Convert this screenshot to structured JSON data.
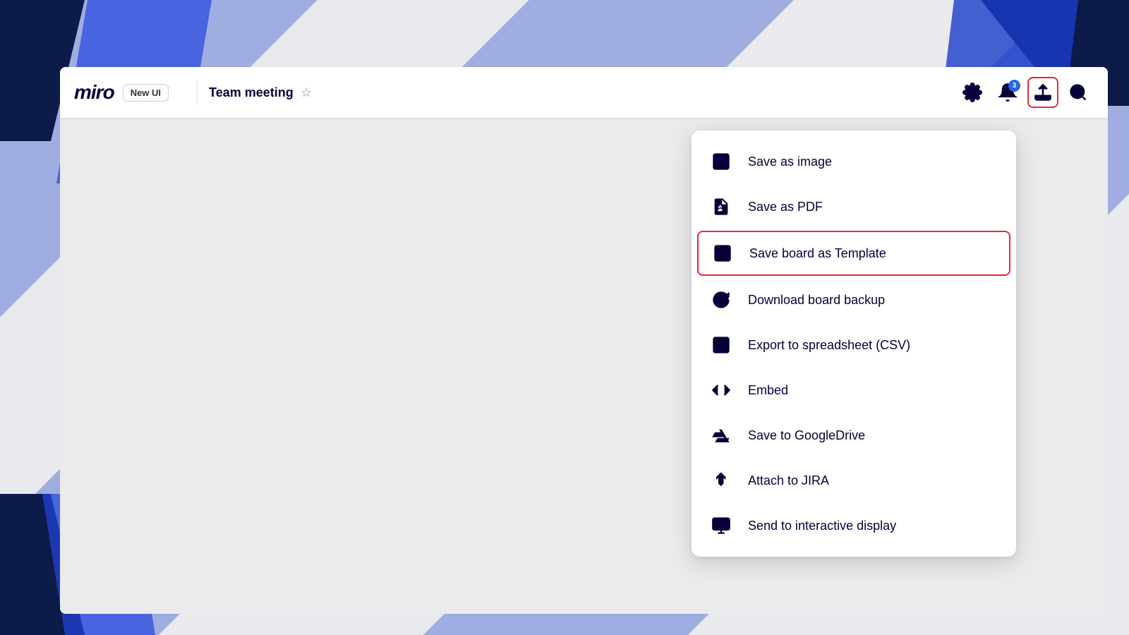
{
  "app": {
    "logo": "miro",
    "new_ui_label": "New UI",
    "board_title": "Team meeting"
  },
  "toolbar": {
    "notification_count": "3",
    "settings_icon": "gear-icon",
    "notifications_icon": "bell-icon",
    "export_icon": "export-icon",
    "search_icon": "search-icon"
  },
  "dropdown": {
    "items": [
      {
        "id": "save-image",
        "label": "Save as image",
        "icon": "image-icon"
      },
      {
        "id": "save-pdf",
        "label": "Save as PDF",
        "icon": "pdf-icon"
      },
      {
        "id": "save-template",
        "label": "Save board as Template",
        "icon": "template-icon",
        "highlighted": true
      },
      {
        "id": "download-backup",
        "label": "Download board backup",
        "icon": "backup-icon"
      },
      {
        "id": "export-csv",
        "label": "Export to spreadsheet (CSV)",
        "icon": "spreadsheet-icon"
      },
      {
        "id": "embed",
        "label": "Embed",
        "icon": "embed-icon"
      },
      {
        "id": "save-drive",
        "label": "Save to GoogleDrive",
        "icon": "drive-icon"
      },
      {
        "id": "attach-jira",
        "label": "Attach to JIRA",
        "icon": "jira-icon"
      },
      {
        "id": "interactive-display",
        "label": "Send to interactive display",
        "icon": "display-icon"
      }
    ]
  },
  "colors": {
    "accent_red": "#e8273c",
    "brand_navy": "#050038",
    "brand_blue": "#2244dd"
  }
}
